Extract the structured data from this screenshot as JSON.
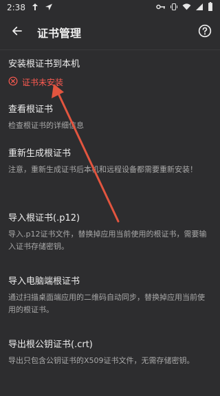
{
  "status": {
    "time": "2:38"
  },
  "header": {
    "title": "证书管理"
  },
  "items": [
    {
      "title": "安装根证书到本机",
      "error": "证书未安装"
    },
    {
      "title": "查看根证书",
      "sub": "检查根证书的详细信息"
    },
    {
      "title": "重新生成根证书",
      "sub": "注意，重新生成证书后本机和远程设备都需要重新安装！"
    },
    {
      "title": "导入根证书(.p12)",
      "sub": "导入.p12证书文件，替换掉应用当前使用的根证书，需要输入证书存储密钥。"
    },
    {
      "title": "导入电脑端根证书",
      "sub": "通过扫描桌面端应用的二维码自动同步，替换掉应用当前使用的根证书。"
    },
    {
      "title": "导出根公钥证书(.crt)",
      "sub": "导出只包含公钥证书的X509证书文件，无需存储密钥。"
    }
  ],
  "colors": {
    "background": "#2d2d2f",
    "error": "#ff5b51",
    "annotation_arrow": "#e2553f"
  }
}
